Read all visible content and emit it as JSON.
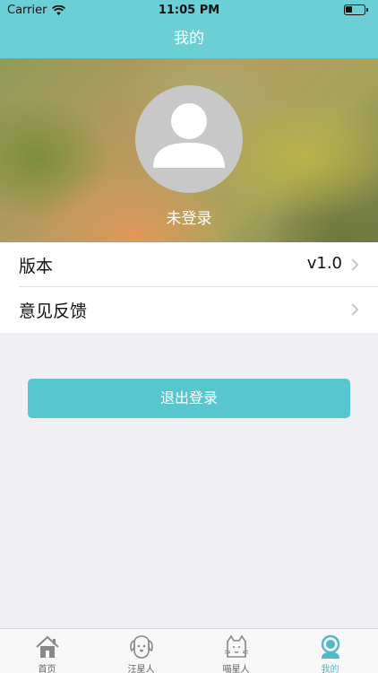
{
  "status_bar": {
    "carrier": "Carrier",
    "time": "11:05 PM"
  },
  "nav": {
    "title": "我的"
  },
  "profile": {
    "status": "未登录"
  },
  "settings": {
    "items": [
      {
        "label": "版本",
        "value": "v1.0"
      },
      {
        "label": "意见反馈",
        "value": ""
      }
    ]
  },
  "actions": {
    "logout_label": "退出登录"
  },
  "tabbar": {
    "tabs": [
      {
        "label": "首页",
        "icon": "home-icon"
      },
      {
        "label": "汪星人",
        "icon": "dog-icon"
      },
      {
        "label": "喵星人",
        "icon": "cat-icon"
      },
      {
        "label": "我的",
        "icon": "profile-icon"
      }
    ],
    "active_index": 3
  },
  "colors": {
    "accent": "#6ccfd6",
    "button": "#58c6cf",
    "active_tab": "#4fb9c5"
  }
}
